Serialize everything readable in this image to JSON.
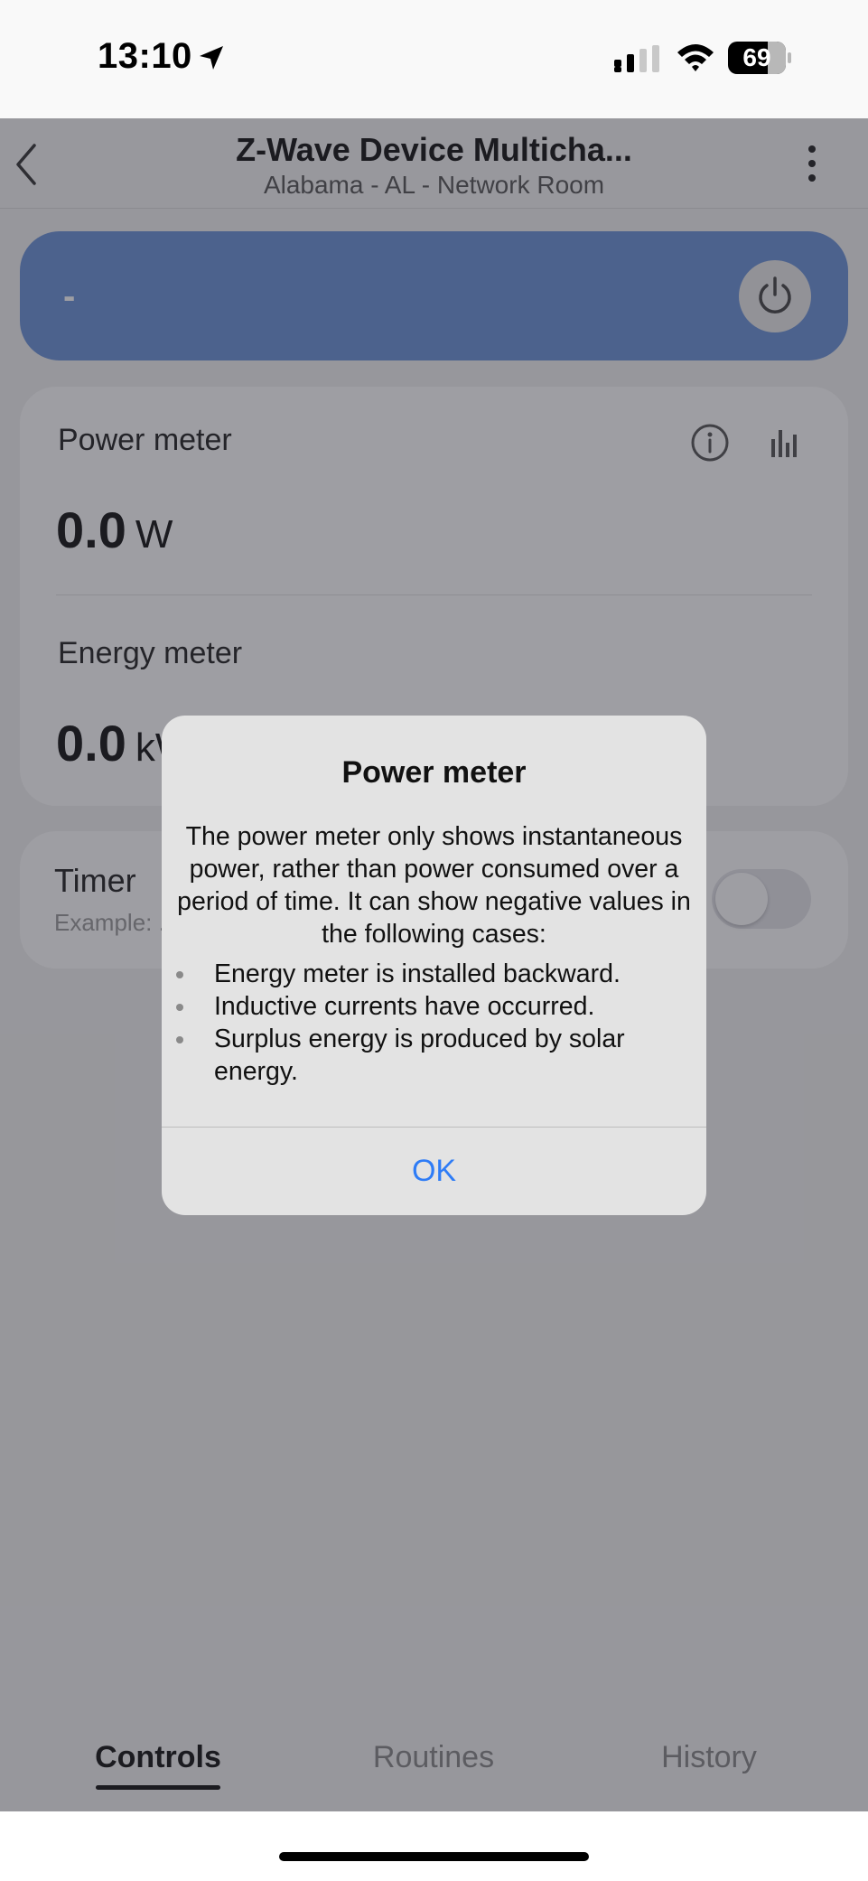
{
  "status_bar": {
    "time": "13:10",
    "battery": "69",
    "battery_level_percent": 69
  },
  "header": {
    "title": "Z-Wave Device Multicha...",
    "subtitle": "Alabama - AL - Network Room"
  },
  "status_card": {
    "value": "-",
    "accent_color": "#6a92d8"
  },
  "meters": {
    "power_label": "Power meter",
    "power_value": "0.0",
    "power_unit": "W",
    "energy_label": "Energy meter",
    "energy_value": "0.0",
    "energy_unit": "kWh"
  },
  "timer": {
    "label": "Timer",
    "sublabel": "Example: ...",
    "enabled": false
  },
  "tabs": [
    {
      "label": "Controls",
      "active": true
    },
    {
      "label": "Routines",
      "active": false
    },
    {
      "label": "History",
      "active": false
    }
  ],
  "dialog": {
    "title": "Power meter",
    "body": "The power meter only shows instantaneous power, rather than power consumed over a period of time. It can show negative values in the following cases:",
    "items": [
      "Energy meter is installed backward.",
      "Inductive currents have occurred.",
      "Surplus energy is produced by solar energy."
    ],
    "ok_label": "OK",
    "ok_color": "#2e7cf6"
  },
  "icons": [
    "location-arrow-icon",
    "signal-icon",
    "wifi-icon",
    "battery-icon",
    "back-chevron-icon",
    "more-vertical-icon",
    "power-icon",
    "info-icon",
    "bar-chart-icon"
  ]
}
